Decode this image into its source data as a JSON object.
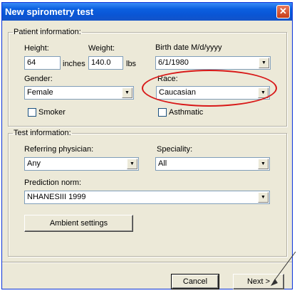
{
  "window": {
    "title": "New spirometry test",
    "close_glyph": "✕"
  },
  "patient_info": {
    "legend": "Patient information:",
    "height": {
      "label": "Height:",
      "value": "64",
      "unit": "inches"
    },
    "weight": {
      "label": "Weight:",
      "value": "140.0",
      "unit": "lbs"
    },
    "birth_date": {
      "label": "Birth date M/d/yyyy",
      "value": "6/1/1980"
    },
    "gender": {
      "label": "Gender:",
      "value": "Female"
    },
    "race": {
      "label": "Race:",
      "value": "Caucasian"
    },
    "smoker": {
      "label": "Smoker",
      "checked": false
    },
    "asthmatic": {
      "label": "Asthmatic",
      "checked": false
    }
  },
  "test_info": {
    "legend": "Test information:",
    "referring_physician": {
      "label": "Referring physician:",
      "value": "Any"
    },
    "speciality": {
      "label": "Speciality:",
      "value": "All"
    },
    "prediction_norm": {
      "label": "Prediction norm:",
      "value": "NHANESIII 1999"
    },
    "ambient_settings_label": "Ambient settings"
  },
  "footer": {
    "cancel_label": "Cancel",
    "next_label": "Next >"
  },
  "icons": {
    "dropdown": "chevron-down-icon",
    "close": "close-icon"
  },
  "colors": {
    "title_bar": "#0a55d4",
    "dialog_bg": "#ece9d8",
    "annotation": "#d81818"
  },
  "annotation": {
    "type": "ellipse-highlight",
    "target": "race-dropdown"
  }
}
